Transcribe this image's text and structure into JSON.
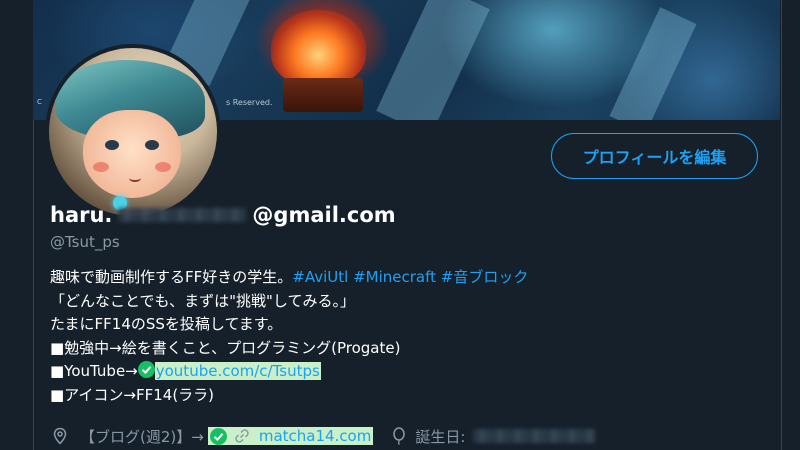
{
  "banner": {
    "copyright_left": "C",
    "copyright": "s Reserved."
  },
  "profile": {
    "name_prefix": "haru.",
    "name_suffix": "@gmail.com",
    "username": "@Tsut_ps",
    "edit_button_label": "プロフィールを編集"
  },
  "bio": {
    "line1_text": "趣味で動画制作するFF好きの学生。",
    "hashtags": [
      "#AviUtl",
      "#Minecraft",
      "#音ブロック"
    ],
    "line2": "「どんなことでも、まずは\"挑戦\"してみる。」",
    "line3": "たまにFF14のSSを投稿してます。",
    "line4": "■勉強中→絵を書くこと、プログラミング(Progate)",
    "line5_prefix": "■YouTube→",
    "youtube_link": "youtube.com/c/Tsutps",
    "line6": "■アイコン→FF14(ララ)"
  },
  "meta": {
    "location": "【ブログ(週2)】→",
    "website": "matcha14.com",
    "birthday_label": "誕生日:"
  },
  "icons": {
    "location": "location-pin-icon",
    "verified": "check-circle-icon",
    "link": "link-icon",
    "birthday": "balloon-icon"
  },
  "colors": {
    "background": "#15202b",
    "accent": "#1da1f2",
    "secondary_text": "#8899a6",
    "verified_green": "#17bf63",
    "highlight": "#c9f0c9"
  }
}
